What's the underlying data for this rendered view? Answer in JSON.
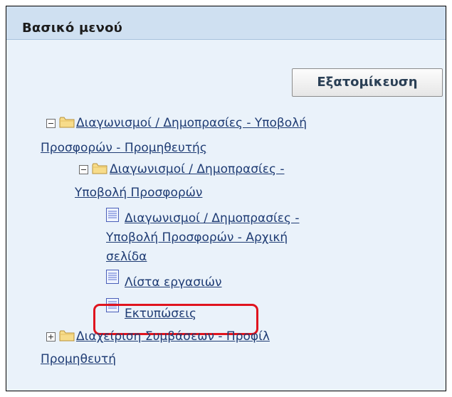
{
  "panel": {
    "title": "Βασικό μενού",
    "personalize_label": "Εξατομίκευση"
  },
  "tree": {
    "node1": {
      "line1": "Διαγωνισμοί / Δημοπρασίες - Υποβολή",
      "line2": "Προσφορών - Προμηθευτής"
    },
    "node2": {
      "line1": "Διαγωνισμοί / Δημοπρασίες -",
      "line2": "Υποβολή Προσφορών"
    },
    "leaf1": {
      "line1": "Διαγωνισμοί / Δημοπρασίες -",
      "line2": "Υποβολή Προσφορών - Αρχική",
      "line3": "σελίδα"
    },
    "leaf2": "Λίστα εργασιών",
    "leaf3": "Εκτυπώσεις",
    "node3": {
      "line1": "Διαχείριση Συμβάσεων - Προφίλ",
      "line2": "Προμηθευτή"
    }
  },
  "icons": {
    "expanded": "minus-box-icon",
    "collapsed": "plus-box-icon",
    "folder": "folder-icon",
    "document": "document-icon"
  },
  "colors": {
    "link": "#1f3c74",
    "highlight": "#e0141e",
    "header_bg": "#cfe0f1",
    "panel_bg": "#eaf2fa"
  }
}
